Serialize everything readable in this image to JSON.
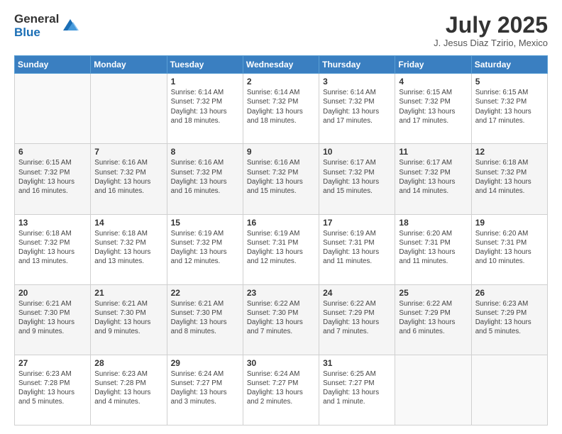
{
  "logo": {
    "general": "General",
    "blue": "Blue"
  },
  "title": {
    "month": "July 2025",
    "location": "J. Jesus Diaz Tzirio, Mexico"
  },
  "weekdays": [
    "Sunday",
    "Monday",
    "Tuesday",
    "Wednesday",
    "Thursday",
    "Friday",
    "Saturday"
  ],
  "rows": [
    [
      {
        "day": "",
        "info": ""
      },
      {
        "day": "",
        "info": ""
      },
      {
        "day": "1",
        "info": "Sunrise: 6:14 AM\nSunset: 7:32 PM\nDaylight: 13 hours\nand 18 minutes."
      },
      {
        "day": "2",
        "info": "Sunrise: 6:14 AM\nSunset: 7:32 PM\nDaylight: 13 hours\nand 18 minutes."
      },
      {
        "day": "3",
        "info": "Sunrise: 6:14 AM\nSunset: 7:32 PM\nDaylight: 13 hours\nand 17 minutes."
      },
      {
        "day": "4",
        "info": "Sunrise: 6:15 AM\nSunset: 7:32 PM\nDaylight: 13 hours\nand 17 minutes."
      },
      {
        "day": "5",
        "info": "Sunrise: 6:15 AM\nSunset: 7:32 PM\nDaylight: 13 hours\nand 17 minutes."
      }
    ],
    [
      {
        "day": "6",
        "info": "Sunrise: 6:15 AM\nSunset: 7:32 PM\nDaylight: 13 hours\nand 16 minutes."
      },
      {
        "day": "7",
        "info": "Sunrise: 6:16 AM\nSunset: 7:32 PM\nDaylight: 13 hours\nand 16 minutes."
      },
      {
        "day": "8",
        "info": "Sunrise: 6:16 AM\nSunset: 7:32 PM\nDaylight: 13 hours\nand 16 minutes."
      },
      {
        "day": "9",
        "info": "Sunrise: 6:16 AM\nSunset: 7:32 PM\nDaylight: 13 hours\nand 15 minutes."
      },
      {
        "day": "10",
        "info": "Sunrise: 6:17 AM\nSunset: 7:32 PM\nDaylight: 13 hours\nand 15 minutes."
      },
      {
        "day": "11",
        "info": "Sunrise: 6:17 AM\nSunset: 7:32 PM\nDaylight: 13 hours\nand 14 minutes."
      },
      {
        "day": "12",
        "info": "Sunrise: 6:18 AM\nSunset: 7:32 PM\nDaylight: 13 hours\nand 14 minutes."
      }
    ],
    [
      {
        "day": "13",
        "info": "Sunrise: 6:18 AM\nSunset: 7:32 PM\nDaylight: 13 hours\nand 13 minutes."
      },
      {
        "day": "14",
        "info": "Sunrise: 6:18 AM\nSunset: 7:32 PM\nDaylight: 13 hours\nand 13 minutes."
      },
      {
        "day": "15",
        "info": "Sunrise: 6:19 AM\nSunset: 7:32 PM\nDaylight: 13 hours\nand 12 minutes."
      },
      {
        "day": "16",
        "info": "Sunrise: 6:19 AM\nSunset: 7:31 PM\nDaylight: 13 hours\nand 12 minutes."
      },
      {
        "day": "17",
        "info": "Sunrise: 6:19 AM\nSunset: 7:31 PM\nDaylight: 13 hours\nand 11 minutes."
      },
      {
        "day": "18",
        "info": "Sunrise: 6:20 AM\nSunset: 7:31 PM\nDaylight: 13 hours\nand 11 minutes."
      },
      {
        "day": "19",
        "info": "Sunrise: 6:20 AM\nSunset: 7:31 PM\nDaylight: 13 hours\nand 10 minutes."
      }
    ],
    [
      {
        "day": "20",
        "info": "Sunrise: 6:21 AM\nSunset: 7:30 PM\nDaylight: 13 hours\nand 9 minutes."
      },
      {
        "day": "21",
        "info": "Sunrise: 6:21 AM\nSunset: 7:30 PM\nDaylight: 13 hours\nand 9 minutes."
      },
      {
        "day": "22",
        "info": "Sunrise: 6:21 AM\nSunset: 7:30 PM\nDaylight: 13 hours\nand 8 minutes."
      },
      {
        "day": "23",
        "info": "Sunrise: 6:22 AM\nSunset: 7:30 PM\nDaylight: 13 hours\nand 7 minutes."
      },
      {
        "day": "24",
        "info": "Sunrise: 6:22 AM\nSunset: 7:29 PM\nDaylight: 13 hours\nand 7 minutes."
      },
      {
        "day": "25",
        "info": "Sunrise: 6:22 AM\nSunset: 7:29 PM\nDaylight: 13 hours\nand 6 minutes."
      },
      {
        "day": "26",
        "info": "Sunrise: 6:23 AM\nSunset: 7:29 PM\nDaylight: 13 hours\nand 5 minutes."
      }
    ],
    [
      {
        "day": "27",
        "info": "Sunrise: 6:23 AM\nSunset: 7:28 PM\nDaylight: 13 hours\nand 5 minutes."
      },
      {
        "day": "28",
        "info": "Sunrise: 6:23 AM\nSunset: 7:28 PM\nDaylight: 13 hours\nand 4 minutes."
      },
      {
        "day": "29",
        "info": "Sunrise: 6:24 AM\nSunset: 7:27 PM\nDaylight: 13 hours\nand 3 minutes."
      },
      {
        "day": "30",
        "info": "Sunrise: 6:24 AM\nSunset: 7:27 PM\nDaylight: 13 hours\nand 2 minutes."
      },
      {
        "day": "31",
        "info": "Sunrise: 6:25 AM\nSunset: 7:27 PM\nDaylight: 13 hours\nand 1 minute."
      },
      {
        "day": "",
        "info": ""
      },
      {
        "day": "",
        "info": ""
      }
    ]
  ]
}
